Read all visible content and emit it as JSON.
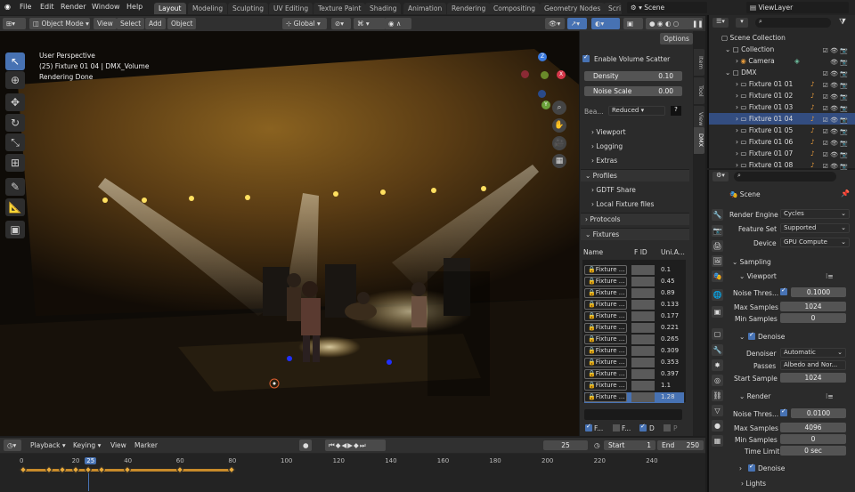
{
  "topbar": {
    "menus": [
      "File",
      "Edit",
      "Render",
      "Window",
      "Help"
    ],
    "workspaces": [
      "Layout",
      "Modeling",
      "Sculpting",
      "UV Editing",
      "Texture Paint",
      "Shading",
      "Animation",
      "Rendering",
      "Compositing",
      "Geometry Nodes",
      "Scri"
    ],
    "active_workspace": "Layout",
    "scene": "Scene",
    "view_layer": "ViewLayer"
  },
  "viewport_header": {
    "mode": "Object Mode",
    "menus": [
      "View",
      "Select",
      "Add",
      "Object"
    ],
    "orientation": "Global",
    "options": "Options"
  },
  "viewport": {
    "overlay_line1": "User Perspective",
    "overlay_line2": "(25) Fixture 01 04 | DMX_Volume",
    "overlay_line3": "Rendering Done",
    "gizmo_axes": [
      "Z",
      "Y",
      "X"
    ]
  },
  "npanel": {
    "enable_volume_scatter": "Enable Volume Scatter",
    "density_label": "Density",
    "density_value": "0.10",
    "noise_scale_label": "Noise Scale",
    "noise_scale_value": "0.00",
    "beam_label": "Bea...",
    "beam_value": "Reduced",
    "viewport": "Viewport",
    "logging": "Logging",
    "extras": "Extras",
    "profiles": "Profiles",
    "gdtf_share": "GDTF Share",
    "local_fixture_files": "Local Fixture files",
    "protocols": "Protocols",
    "fixtures": "Fixtures",
    "col_name": "Name",
    "col_fid": "F ID",
    "col_uni": "Uni.A...",
    "fixture_label": "Fixture ...",
    "fixture_values": [
      "0.1",
      "0.45",
      "0.89",
      "0.133",
      "0.177",
      "0.221",
      "0.265",
      "0.309",
      "0.353",
      "0.397",
      "1.1",
      "1.28"
    ],
    "footer_f1": "F...",
    "footer_f2": "F...",
    "footer_d": "D",
    "footer_p": "P",
    "tabs": [
      "Item",
      "Tool",
      "View",
      "DMX"
    ]
  },
  "outliner": {
    "scene_collection": "Scene Collection",
    "collection": "Collection",
    "camera": "Camera",
    "dmx": "DMX",
    "fixtures": [
      "Fixture 01 01",
      "Fixture 01 02",
      "Fixture 01 03",
      "Fixture 01 04",
      "Fixture 01 05",
      "Fixture 01 06",
      "Fixture 01 07",
      "Fixture 01 08"
    ]
  },
  "properties": {
    "scene": "Scene",
    "render_engine_label": "Render Engine",
    "render_engine": "Cycles",
    "feature_set_label": "Feature Set",
    "feature_set": "Supported",
    "device_label": "Device",
    "device": "GPU Compute",
    "sampling": "Sampling",
    "viewport": "Viewport",
    "noise_thres_label": "Noise Thres...",
    "vp_noise_thres": "0.1000",
    "max_samples_label": "Max Samples",
    "vp_max_samples": "1024",
    "min_samples_label": "Min Samples",
    "vp_min_samples": "0",
    "denoise": "Denoise",
    "denoiser_label": "Denoiser",
    "denoiser": "Automatic",
    "passes_label": "Passes",
    "passes": "Albedo and Nor...",
    "start_sample_label": "Start Sample",
    "start_sample": "1024",
    "render": "Render",
    "r_noise_thres": "0.0100",
    "r_max_samples": "4096",
    "r_min_samples": "0",
    "time_limit_label": "Time Limit",
    "time_limit": "0 sec",
    "denoise2": "Denoise",
    "lights": "Lights"
  },
  "timeline": {
    "playback": "Playback",
    "keying": "Keying",
    "view": "View",
    "marker": "Marker",
    "current_frame": "25",
    "start_label": "Start",
    "start": "1",
    "end_label": "End",
    "end": "250",
    "ticks": [
      "0",
      "20",
      "25",
      "40",
      "60",
      "80",
      "100",
      "120",
      "140",
      "160",
      "180",
      "200",
      "220",
      "240"
    ]
  }
}
